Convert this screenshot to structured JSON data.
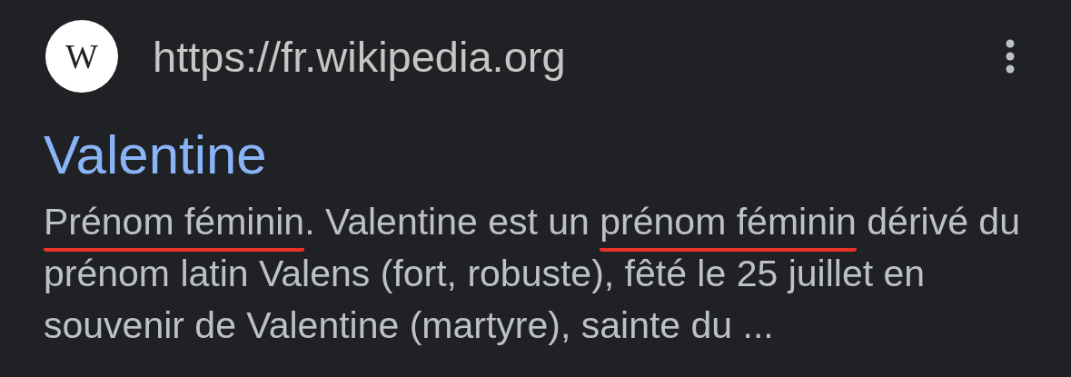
{
  "result": {
    "favicon_letter": "W",
    "url": "https://fr.wikipedia.org",
    "title": "Valentine",
    "snippet": [
      {
        "text": "Prénom féminin",
        "underlined": true
      },
      {
        "text": ". Valentine est un ",
        "underlined": false
      },
      {
        "text": "prénom féminin",
        "underlined": true
      },
      {
        "text": " dérivé du prénom latin Valens (fort, robuste), fêté le 25 juillet en souvenir de Valentine (martyre), sainte du ...",
        "underlined": false
      }
    ]
  }
}
